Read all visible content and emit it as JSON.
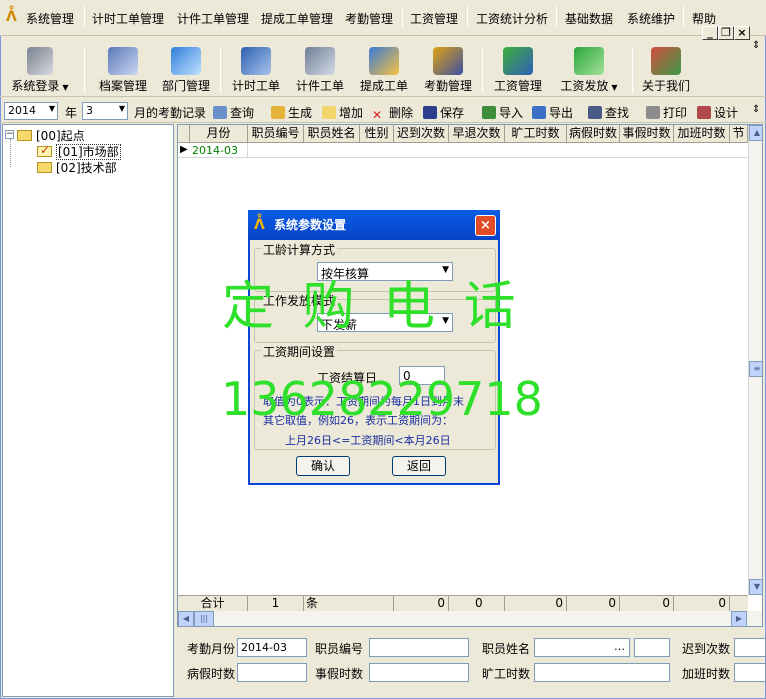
{
  "menu": {
    "items": [
      "系统管理",
      "计时工单管理",
      "计件工单管理",
      "提成工单管理",
      "考勤管理",
      "工资管理",
      "工资统计分析",
      "基础数据",
      "系统维护",
      "帮助"
    ],
    "win_min": "_",
    "win_restore": "❐",
    "win_close": "×"
  },
  "toolbar": {
    "items": [
      "系统登录",
      "档案管理",
      "部门管理",
      "计时工单",
      "计件工单",
      "提成工单",
      "考勤管理",
      "工资管理",
      "工资发放",
      "关于我们"
    ]
  },
  "bar2": {
    "year": "2014",
    "year_label": "年",
    "month": "3",
    "month_label": "月的考勤记录",
    "query": "查询",
    "generate": "生成",
    "add": "增加",
    "delete": "删除",
    "save": "保存",
    "import": "导入",
    "export": "导出",
    "find": "查找",
    "print": "打印",
    "design": "设计"
  },
  "tree": {
    "root": "[00]起点",
    "children": [
      "[01]市场部",
      "[02]技术部"
    ]
  },
  "grid": {
    "columns": [
      "月份",
      "职员编号",
      "职员姓名",
      "性别",
      "迟到次数",
      "早退次数",
      "旷工时数",
      "病假时数",
      "事假时数",
      "加班时数",
      "节"
    ],
    "rows": [
      [
        "2014-03",
        "",
        "",
        "",
        "",
        "",
        "",
        "",
        "",
        "",
        ""
      ]
    ],
    "footer": {
      "label": "合计",
      "count": "1",
      "unit": "条",
      "values": [
        "0",
        "0",
        "0",
        "0",
        "0",
        "0"
      ]
    }
  },
  "form": {
    "month_label": "考勤月份",
    "month_value": "2014-03",
    "emp_no_label": "职员编号",
    "emp_name_label": "职员姓名",
    "late_label": "迟到次数",
    "sick_label": "病假时数",
    "personal_label": "事假时数",
    "absent_label": "旷工时数",
    "overtime_label": "加班时数",
    "ellipsis": "…"
  },
  "dialog": {
    "title": "系统参数设置",
    "close": "×",
    "seniority_group": "工龄计算方式",
    "seniority_value": "按年核算",
    "pay_group": "工作发放模式",
    "pay_value": "下发薪",
    "period_group": "工资期间设置",
    "settle_label": "工资结算日",
    "settle_value": "0",
    "note1": "取值为0表示：工资期间为每月1日到月末",
    "note2": "其它取值，例如26，表示工资期间为：",
    "note3": "上月26日<=工资期间<本月26日",
    "ok": "确认",
    "back": "返回"
  },
  "watermark": {
    "line1": "定 购 电 话",
    "line2": "13628229718"
  },
  "colors": {
    "accent": "#0a46d6",
    "watermark": "#2ee02a",
    "row_text": "#008000",
    "note": "#1a2ea0"
  }
}
